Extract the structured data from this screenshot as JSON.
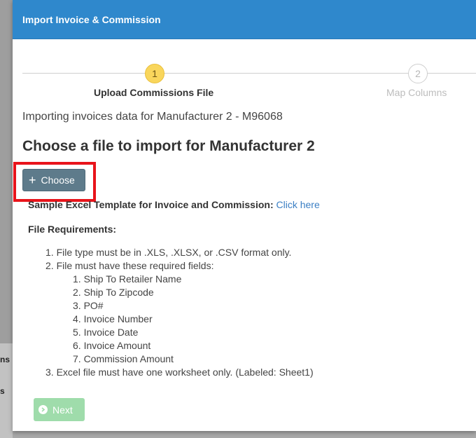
{
  "background": {
    "fragment_1": "ns",
    "fragment_2": "s"
  },
  "modal": {
    "title": "Import Invoice & Commission"
  },
  "stepper": {
    "steps": [
      {
        "number": "1",
        "label": "Upload Commissions File",
        "active": true
      },
      {
        "number": "2",
        "label": "Map Columns",
        "active": false
      }
    ]
  },
  "content": {
    "importing_text": "Importing invoices data for Manufacturer 2 - M96068",
    "heading": "Choose a file to import for Manufacturer 2",
    "choose_button_label": "Choose",
    "template_label": "Sample Excel Template for Invoice and Commission:",
    "template_link": "Click here",
    "requirements_heading": "File Requirements:",
    "requirements": [
      "1. File type must be in .XLS, .XLSX, or .CSV format only.",
      "2. File must have these required fields:",
      "3. Excel file must have one worksheet only. (Labeled: Sheet1)"
    ],
    "required_fields": [
      "1. Ship To Retailer Name",
      "2. Ship To Zipcode",
      "3. PO#",
      "4. Invoice Number",
      "5. Invoice Date",
      "6. Invoice Amount",
      "7. Commission Amount"
    ],
    "next_button_label": "Next"
  },
  "colors": {
    "header_blue": "#2f88cc",
    "active_step": "#f9d65c",
    "choose_button": "#5e7b8b",
    "highlight": "#e8141b",
    "next_button": "#9fdcab",
    "link": "#3b7fc4"
  }
}
